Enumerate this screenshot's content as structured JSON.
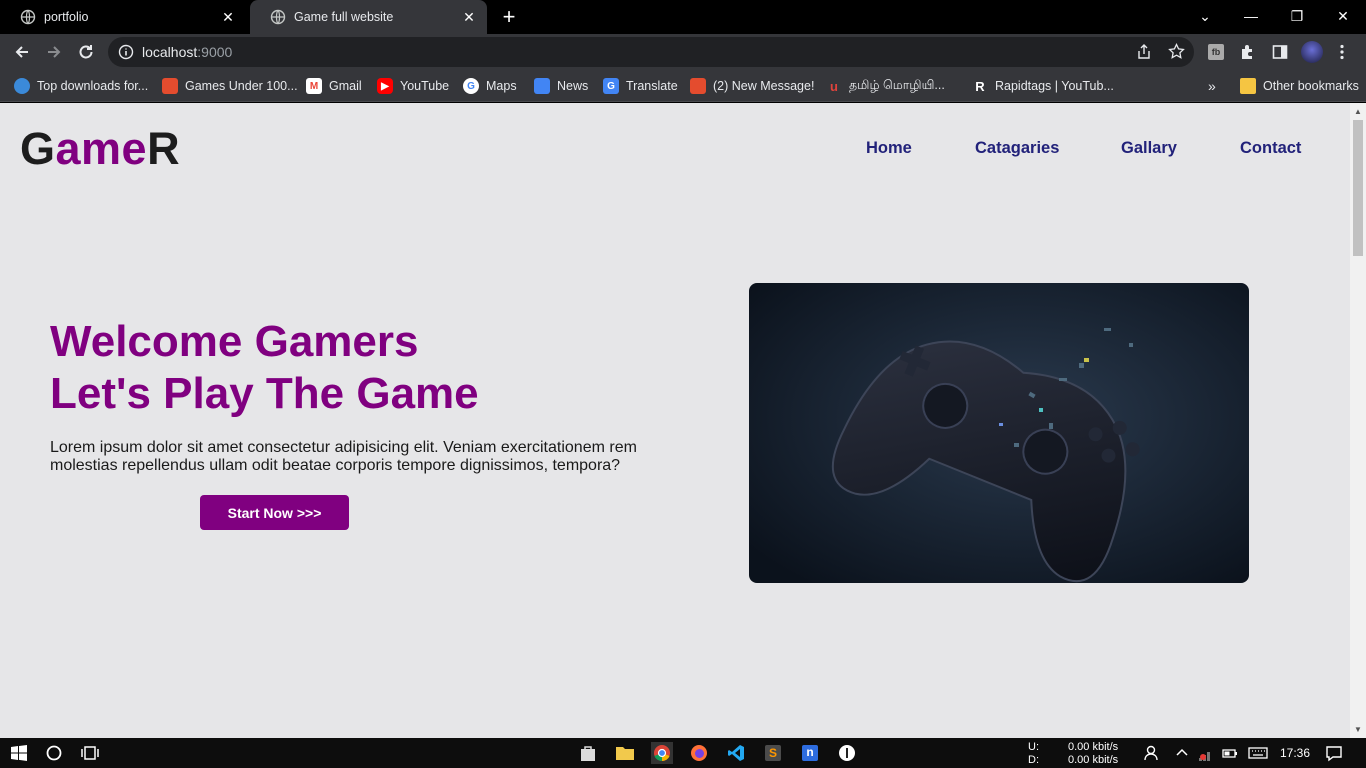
{
  "browser": {
    "tabs": [
      {
        "title": "portfolio"
      },
      {
        "title": "Game full website"
      }
    ],
    "address": {
      "host": "localhost",
      "port": ":9000"
    },
    "bookmarks": [
      {
        "label": "Top downloads for...",
        "icon": "globe-icon",
        "color": "#3b8ad9"
      },
      {
        "label": "Games Under 100...",
        "icon": "app-icon",
        "color": "#e44c2e"
      },
      {
        "label": "Gmail",
        "icon": "gmail-icon",
        "color": "#ea4335"
      },
      {
        "label": "YouTube",
        "icon": "youtube-icon",
        "color": "#ff0000"
      },
      {
        "label": "Maps",
        "icon": "google-icon",
        "color": "#4285f4"
      },
      {
        "label": "News",
        "icon": "news-icon",
        "color": "#4285f4"
      },
      {
        "label": "Translate",
        "icon": "translate-icon",
        "color": "#4285f4"
      },
      {
        "label": "(2) New Message!",
        "icon": "app-icon",
        "color": "#e44c2e"
      },
      {
        "label": "தமிழ் மொழியி...",
        "icon": "u-icon",
        "color": "#e0433c"
      },
      {
        "label": "Rapidtags | YouTub...",
        "icon": "r-icon",
        "color": "#111111"
      }
    ],
    "overflow": "»",
    "other_bookmarks": "Other bookmarks"
  },
  "site": {
    "logo": {
      "start": "G",
      "mid": "ame",
      "end": "R"
    },
    "nav": [
      "Home",
      "Catagaries",
      "Gallary",
      "Contact"
    ],
    "hero": {
      "title_line1": "Welcome Gamers",
      "title_line2": "Let's Play The Game",
      "text": "Lorem ipsum dolor sit amet consectetur adipisicing elit. Veniam exercitationem rem molestias repellendus ullam odit beatae corporis tempore dignissimos, tempora?",
      "button": "Start Now >>>"
    },
    "accent_color": "#800080"
  },
  "taskbar": {
    "net_up_label": "U:",
    "net_down_label": "D:",
    "net_up": "0.00 kbit/s",
    "net_down": "0.00 kbit/s",
    "time": "17:36"
  }
}
